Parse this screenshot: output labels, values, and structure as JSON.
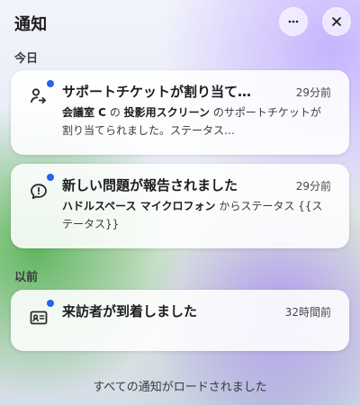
{
  "header": {
    "title": "通知",
    "more_icon": "more-horizontal-icon",
    "close_icon": "close-icon"
  },
  "sections": {
    "today": "今日",
    "past": "以前"
  },
  "notifications": [
    {
      "icon": "person-arrow-icon",
      "title": "サポートチケットが割り当て…",
      "time": "29分前",
      "body": {
        "strong_1": "会議室 C",
        "connector_1": " の ",
        "strong_2": "投影用スクリーン",
        "rest": " のサポートチケットが割り当てられました。ステータス…"
      },
      "unread_color": "#2563eb"
    },
    {
      "icon": "chat-alert-icon",
      "title": "新しい問題が報告されました",
      "time": "29分前",
      "body": {
        "strong_1": "ハドルスペース マイクロフォン",
        "rest": " からステータス {{ステータス}}"
      },
      "unread_color": "#2563eb"
    },
    {
      "icon": "visitor-id-card-icon",
      "title": "来訪者が到着しました",
      "time": "32時間前",
      "body": {},
      "unread_color": "#2563eb"
    }
  ],
  "footer": {
    "status": "すべての通知がロードされました"
  }
}
